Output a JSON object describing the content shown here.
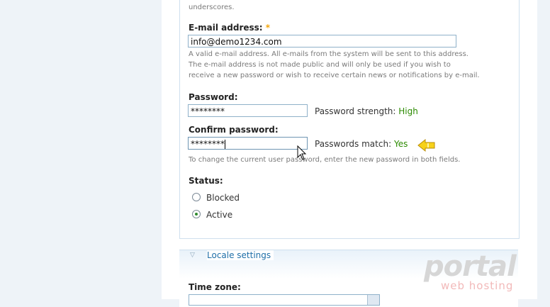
{
  "username_help_tail": "underscores.",
  "email": {
    "label": "E-mail address:",
    "required_mark": "*",
    "value": "info@demo1234.com",
    "help_lines": [
      "A valid e-mail address. All e-mails from the system will be sent to this address.",
      "The e-mail address is not made public and will only be used if you wish to",
      "receive a new password or wish to receive certain news or notifications by e-mail."
    ]
  },
  "password": {
    "label": "Password:",
    "value": "********",
    "strength_label": "Password strength:",
    "strength_value": "High"
  },
  "confirm_password": {
    "label": "Confirm password:",
    "value": "********",
    "match_label": "Passwords match:",
    "match_value": "Yes",
    "help": "To change the current user password, enter the new password in both fields."
  },
  "status": {
    "label": "Status:",
    "options": [
      {
        "label": "Blocked",
        "checked": false
      },
      {
        "label": "Active",
        "checked": true
      }
    ]
  },
  "locale": {
    "legend": "Locale settings",
    "timezone_label": "Time zone:"
  },
  "watermark": {
    "brand": "portal",
    "tagline": "web hosting"
  },
  "colors": {
    "accent_green": "#2b8a00",
    "required_orange": "#f2a60c",
    "link_blue": "#1f6fa8"
  }
}
